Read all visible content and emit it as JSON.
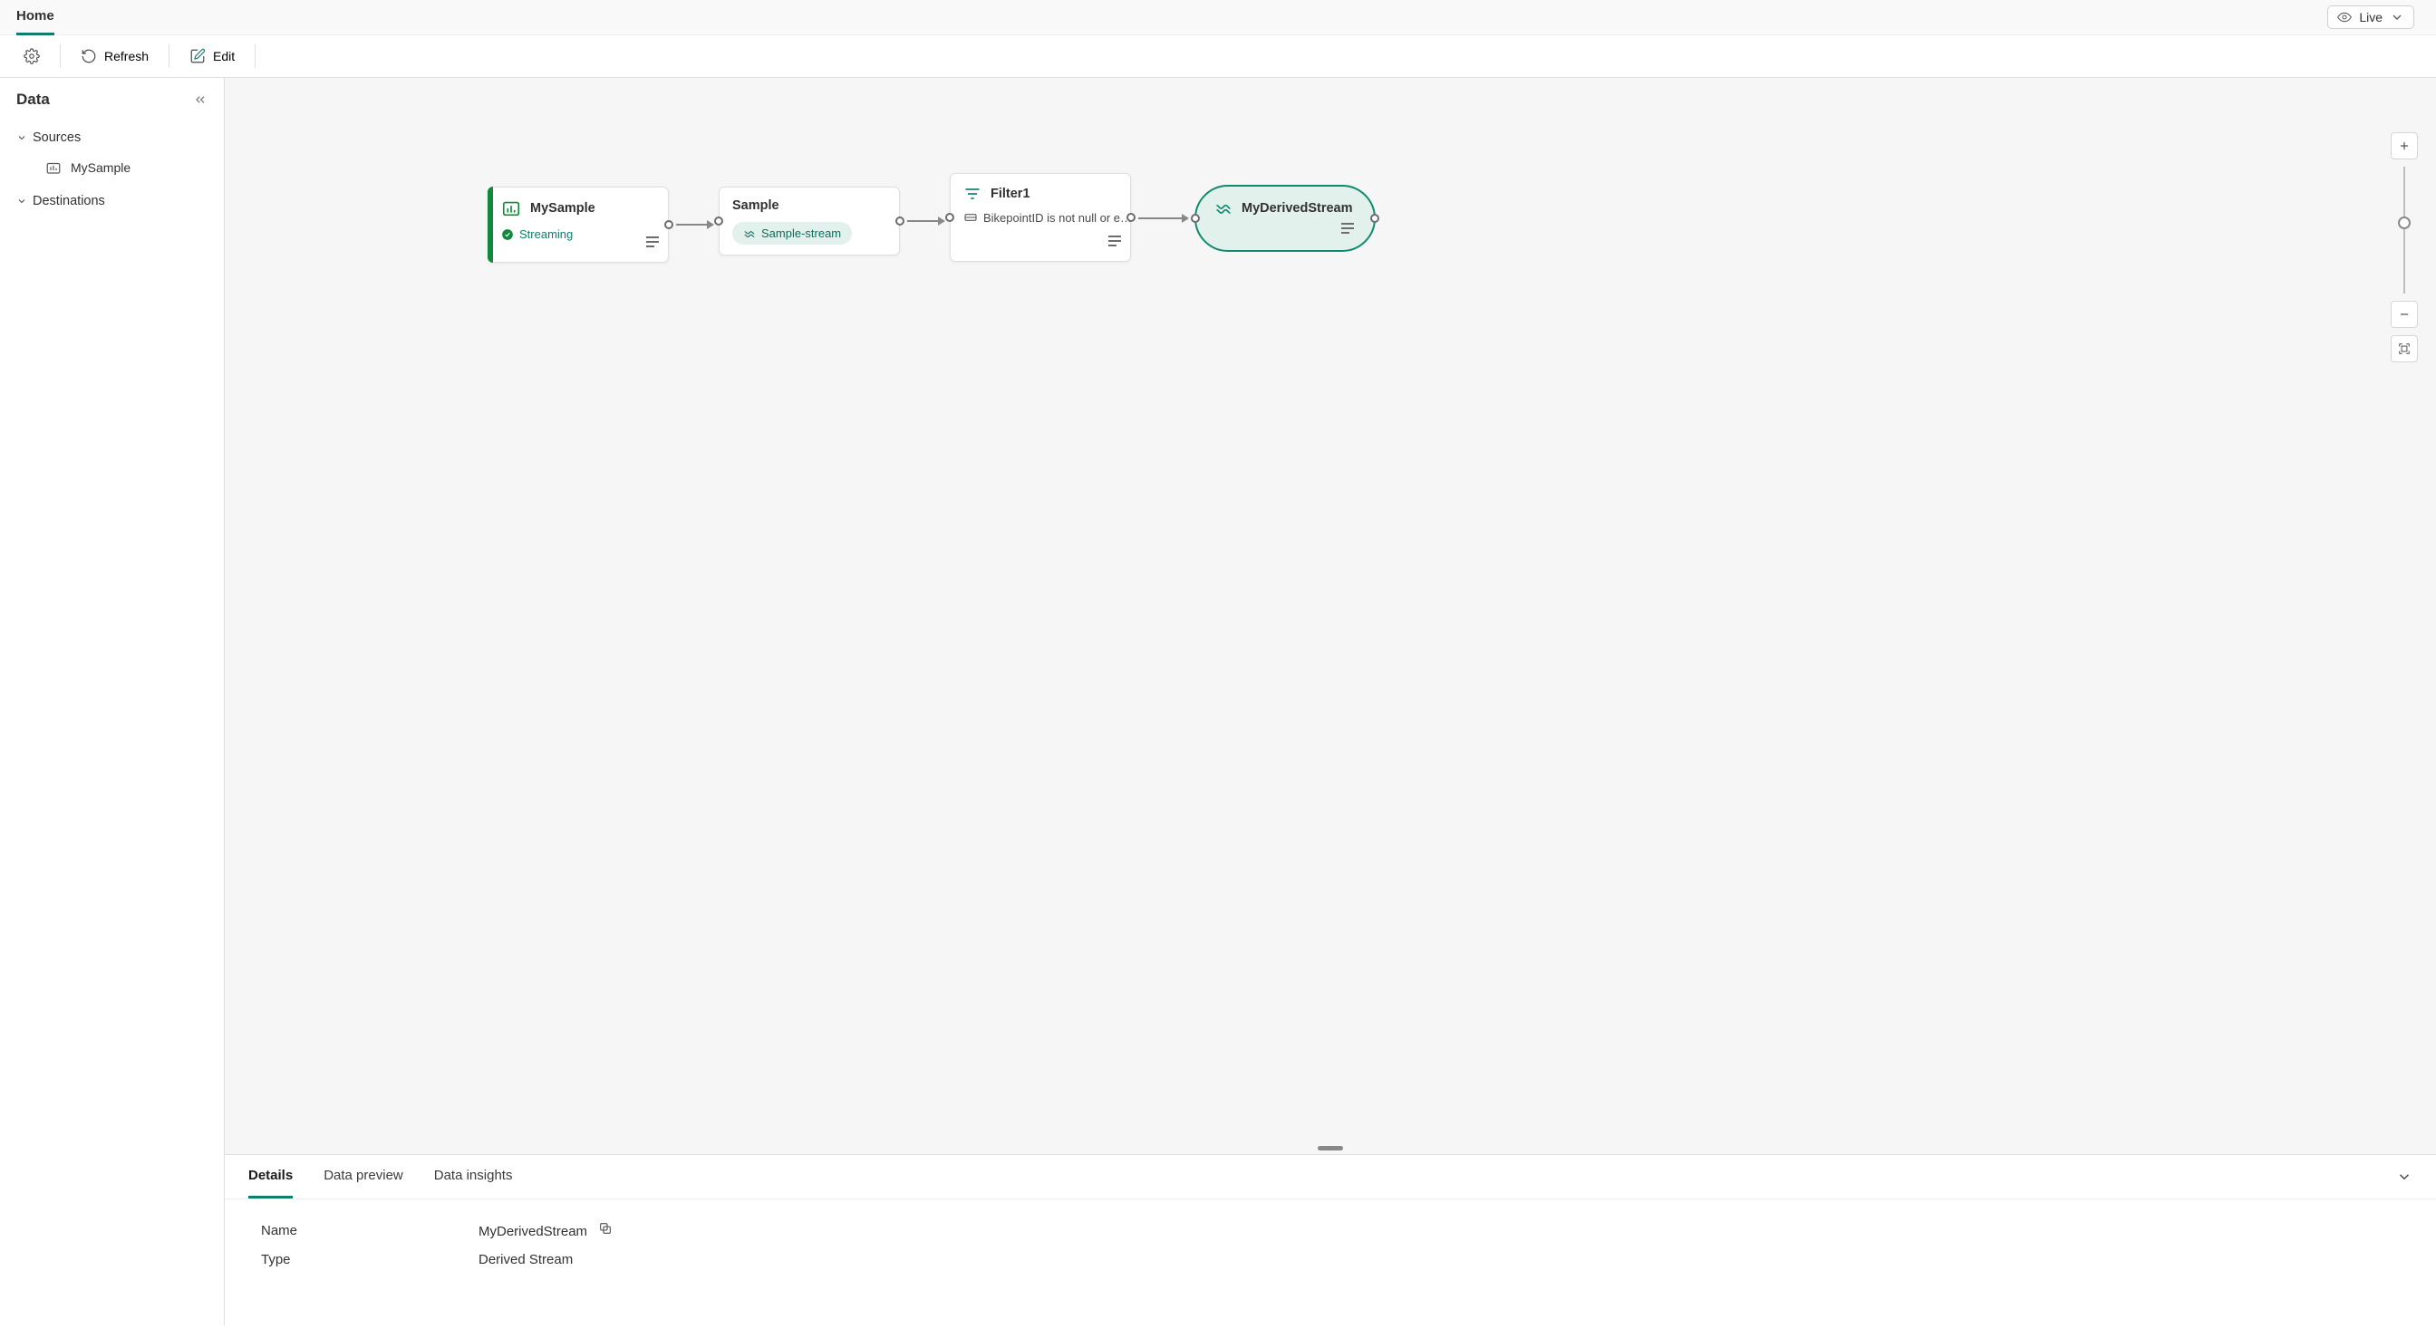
{
  "tabs": {
    "home": "Home"
  },
  "topRight": {
    "live": "Live"
  },
  "toolbar": {
    "refresh": "Refresh",
    "edit": "Edit"
  },
  "sidebar": {
    "title": "Data",
    "sections": {
      "sources": "Sources",
      "destinations": "Destinations"
    },
    "items": {
      "mysample": "MySample"
    }
  },
  "canvas": {
    "mysample": {
      "title": "MySample",
      "status": "Streaming"
    },
    "sample": {
      "title": "Sample",
      "chip": "Sample-stream"
    },
    "filter": {
      "title": "Filter1",
      "expr": "BikepointID is not null or e…"
    },
    "derived": {
      "title": "MyDerivedStream"
    }
  },
  "details": {
    "tabs": {
      "details": "Details",
      "preview": "Data preview",
      "insights": "Data insights"
    },
    "rows": {
      "name_label": "Name",
      "name_value": "MyDerivedStream",
      "type_label": "Type",
      "type_value": "Derived Stream"
    }
  }
}
